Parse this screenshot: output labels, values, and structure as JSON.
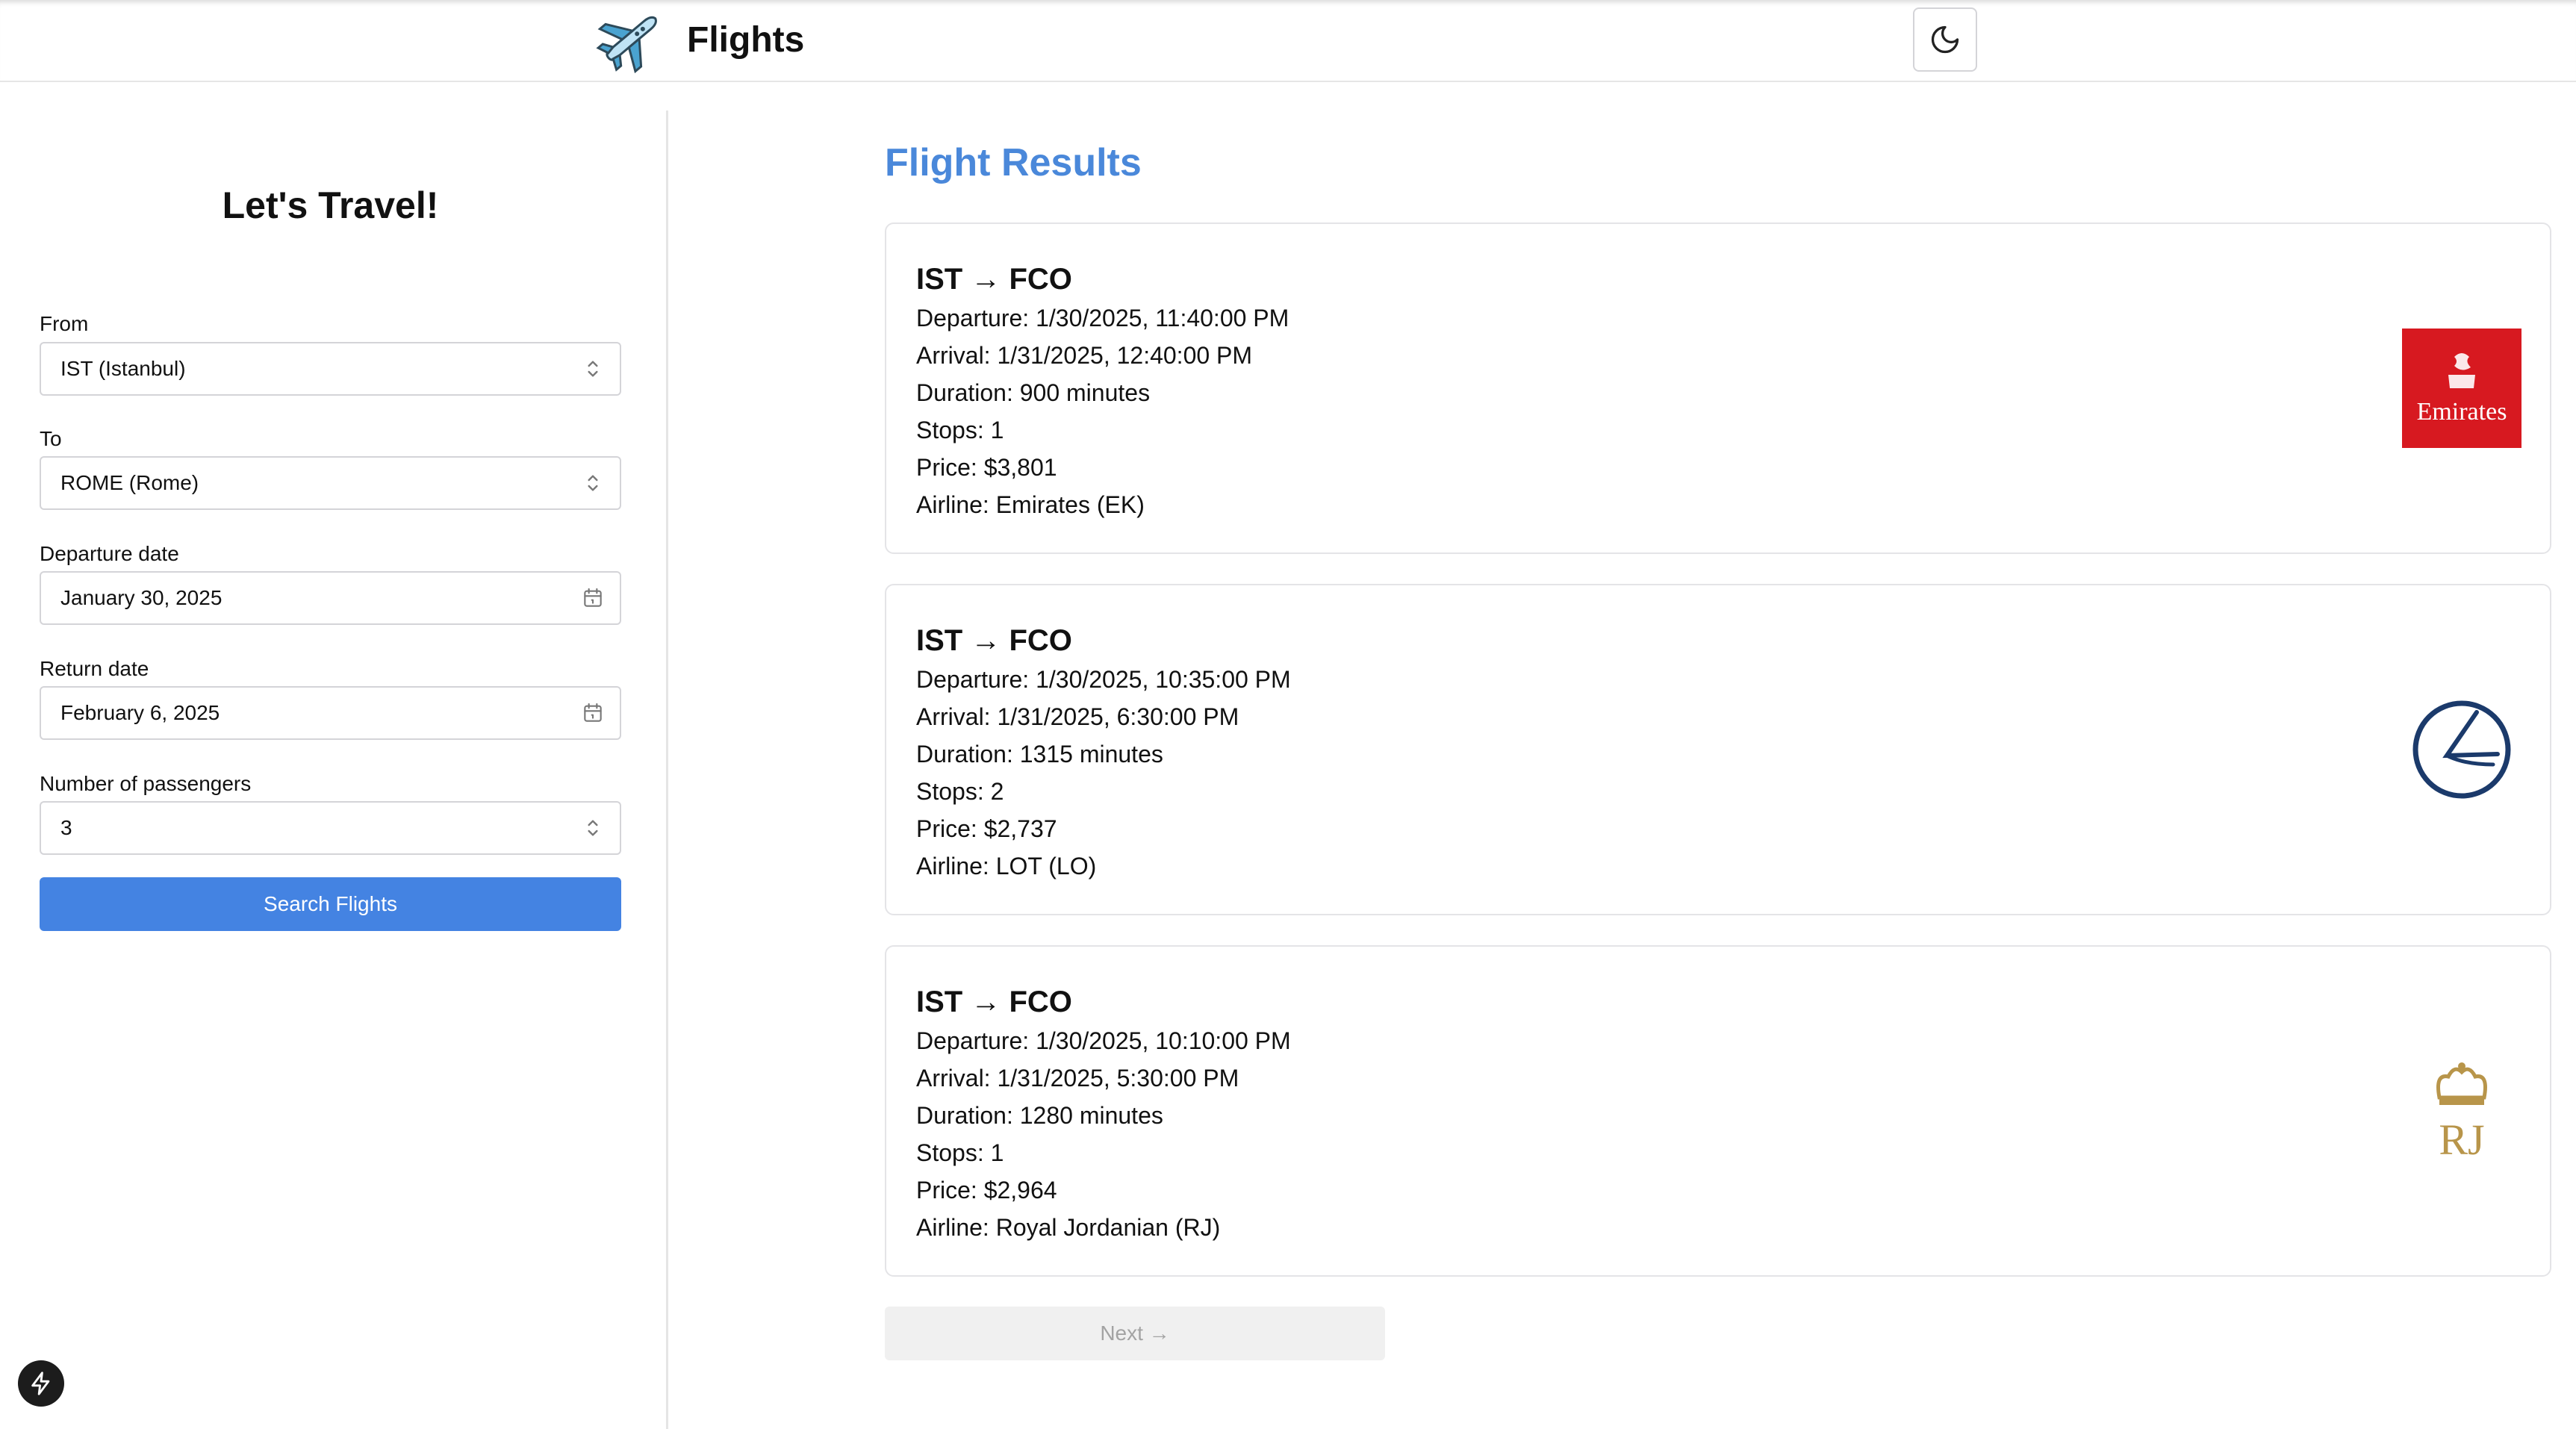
{
  "header": {
    "title": "Flights",
    "logo_icon": "airplane-icon",
    "theme_toggle_icon": "moon-icon"
  },
  "sidebar": {
    "title": "Let's Travel!",
    "from": {
      "label": "From",
      "value": "IST (Istanbul)"
    },
    "to": {
      "label": "To",
      "value": "ROME (Rome)"
    },
    "departure": {
      "label": "Departure date",
      "value": "January 30, 2025"
    },
    "return": {
      "label": "Return date",
      "value": "February 6, 2025"
    },
    "passengers": {
      "label": "Number of passengers",
      "value": "3"
    },
    "search_label": "Search Flights"
  },
  "results": {
    "title": "Flight Results",
    "flights": [
      {
        "route": "IST → FCO",
        "departure": "Departure: 1/30/2025, 11:40:00 PM",
        "arrival": "Arrival: 1/31/2025, 12:40:00 PM",
        "duration": "Duration: 900 minutes",
        "stops": "Stops: 1",
        "price": "Price: $3,801",
        "airline": "Airline: Emirates (EK)",
        "logo_text": "Emirates",
        "logo_color": "#d71920"
      },
      {
        "route": "IST → FCO",
        "departure": "Departure: 1/30/2025, 10:35:00 PM",
        "arrival": "Arrival: 1/31/2025, 6:30:00 PM",
        "duration": "Duration: 1315 minutes",
        "stops": "Stops: 2",
        "price": "Price: $2,737",
        "airline": "Airline: LOT (LO)",
        "logo_color": "#1b3a6b"
      },
      {
        "route": "IST → FCO",
        "departure": "Departure: 1/30/2025, 10:10:00 PM",
        "arrival": "Arrival: 1/31/2025, 5:30:00 PM",
        "duration": "Duration: 1280 minutes",
        "stops": "Stops: 1",
        "price": "Price: $2,964",
        "airline": "Airline: Royal Jordanian (RJ)",
        "logo_text": "RJ",
        "logo_color": "#b8954a"
      }
    ],
    "next_label": "Next →"
  },
  "colors": {
    "accent": "#4a88da",
    "primary_button": "#4483e2",
    "border": "#e4e4e7"
  }
}
